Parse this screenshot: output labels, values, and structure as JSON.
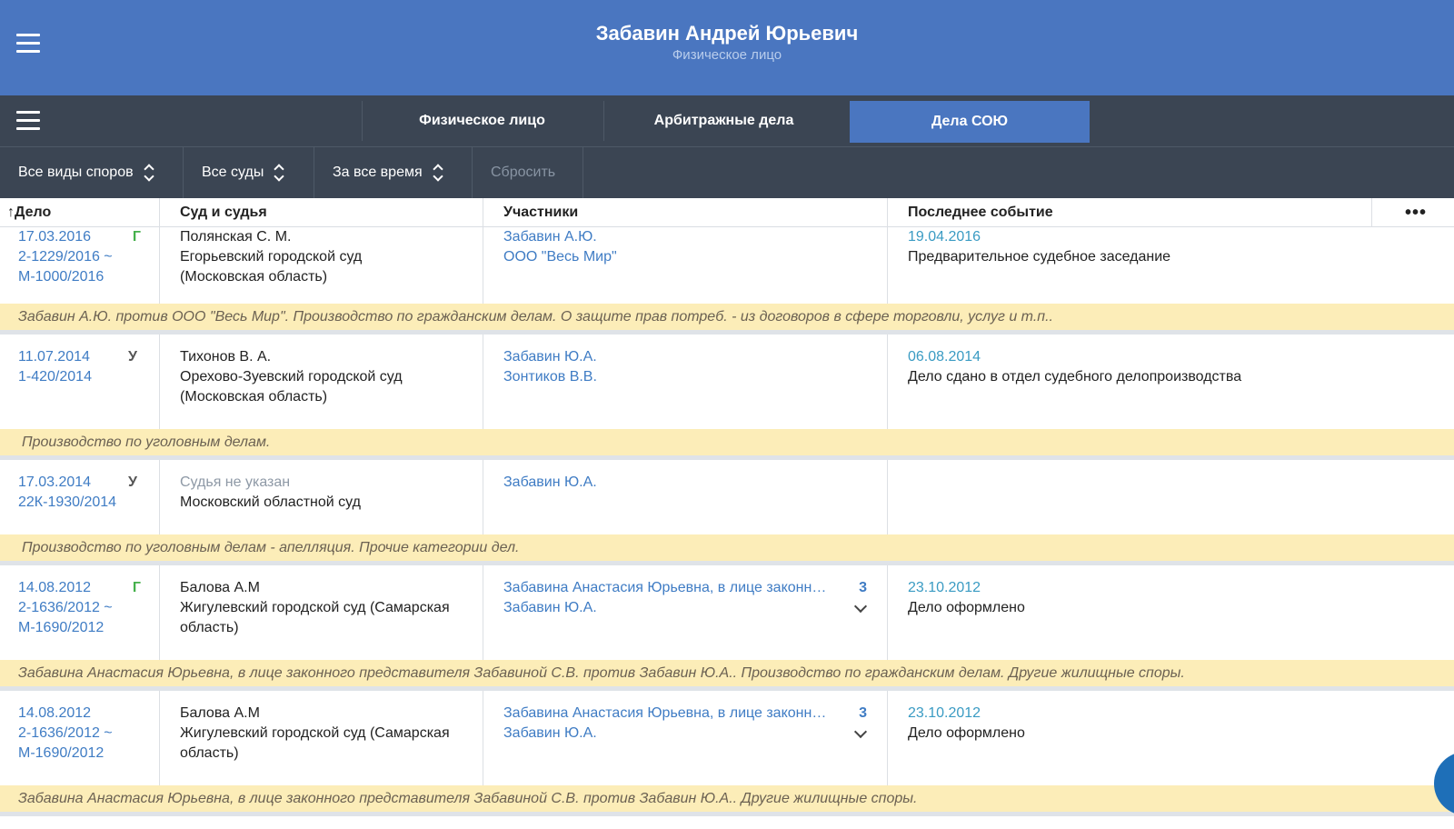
{
  "header": {
    "title": "Забавин Андрей Юрьевич",
    "subtitle": "Физическое лицо",
    "menu_icon": "hamburger-icon"
  },
  "tabs": [
    {
      "label": "Физическое лицо",
      "active": false
    },
    {
      "label": "Арбитражные дела",
      "active": false
    },
    {
      "label": "Дела СОЮ",
      "active": true
    }
  ],
  "filters": {
    "dispute_type": "Все виды споров",
    "courts": "Все суды",
    "period": "За все время",
    "reset": "Сбросить"
  },
  "table": {
    "columns": [
      "Дело",
      "Суд и судья",
      "Участники",
      "Последнее событие"
    ],
    "sort_icon": "↑",
    "more": "•••"
  },
  "cases": [
    {
      "date": "17.03.2016",
      "type": "Г",
      "number": "2-1229/2016 ~",
      "number2": "М-1000/2016",
      "judge": "Полянская С. М.",
      "court": "Егорьевский городской суд",
      "court2": "(Московская область)",
      "participant1": "Забавин А.Ю.",
      "participant2": "ООО \"Весь Мир\"",
      "event_date": "19.04.2016",
      "event": "Предварительное судебное заседание",
      "description": "Забавин А.Ю. против ООО \"Весь Мир\". Производство по гражданским делам. О защите прав потреб. - из договоров в сфере торговли, услуг и т.п.."
    },
    {
      "date": "11.07.2014",
      "type": "У",
      "number": "1-420/2014",
      "judge": "Тихонов В. А.",
      "court": "Орехово-Зуевский городской суд",
      "court2": "(Московская область)",
      "participant1": "Забавин Ю.А.",
      "participant2": "Зонтиков В.В.",
      "event_date": "06.08.2014",
      "event": "Дело сдано в отдел судебного делопроизводства",
      "description": "Производство по уголовным делам."
    },
    {
      "date": "17.03.2014",
      "type": "У",
      "number": "22К-1930/2014",
      "judge": "Судья не указан",
      "court": "Московский областной суд",
      "participant1": "Забавин Ю.А.",
      "description": "Производство по уголовным делам - апелляция. Прочие категории дел."
    },
    {
      "date": "14.08.2012",
      "type": "Г",
      "number": "2-1636/2012 ~",
      "number2": "М-1690/2012",
      "judge": "Балова А.М",
      "court": "Жигулевский городской суд (Самарская",
      "court2": "область)",
      "participant1": "Забавина Анастасия Юрьевна, в лице законного представителя Забавиной С.В.",
      "participant2": "Забавин Ю.А.",
      "participant_count": "3",
      "event_date": "23.10.2012",
      "event": "Дело оформлено",
      "description": "Забавина Анастасия Юрьевна, в лице законного представителя Забавиной С.В. против Забавин Ю.А.. Производство по гражданским делам. Другие жилищные споры."
    },
    {
      "date": "14.08.2012",
      "number": "2-1636/2012 ~",
      "number2": "М-1690/2012",
      "judge": "Балова А.М",
      "court": "Жигулевский городской суд (Самарская",
      "court2": "область)",
      "participant1": "Забавина Анастасия Юрьевна, в лице законного представителя Забавиной С.В.",
      "participant2": "Забавин Ю.А.",
      "participant_count": "3",
      "event_date": "23.10.2012",
      "event": "Дело оформлено",
      "description": "Забавина Анастасия Юрьевна, в лице законного представителя Забавиной С.В. против Забавин Ю.А.. Другие жилищные споры."
    }
  ],
  "colors": {
    "header": "#4a76c0",
    "toolbar": "#3b4553",
    "link": "#3f7cc4",
    "civil_badge": "#44b04a",
    "description_bg": "#fcedb8"
  }
}
